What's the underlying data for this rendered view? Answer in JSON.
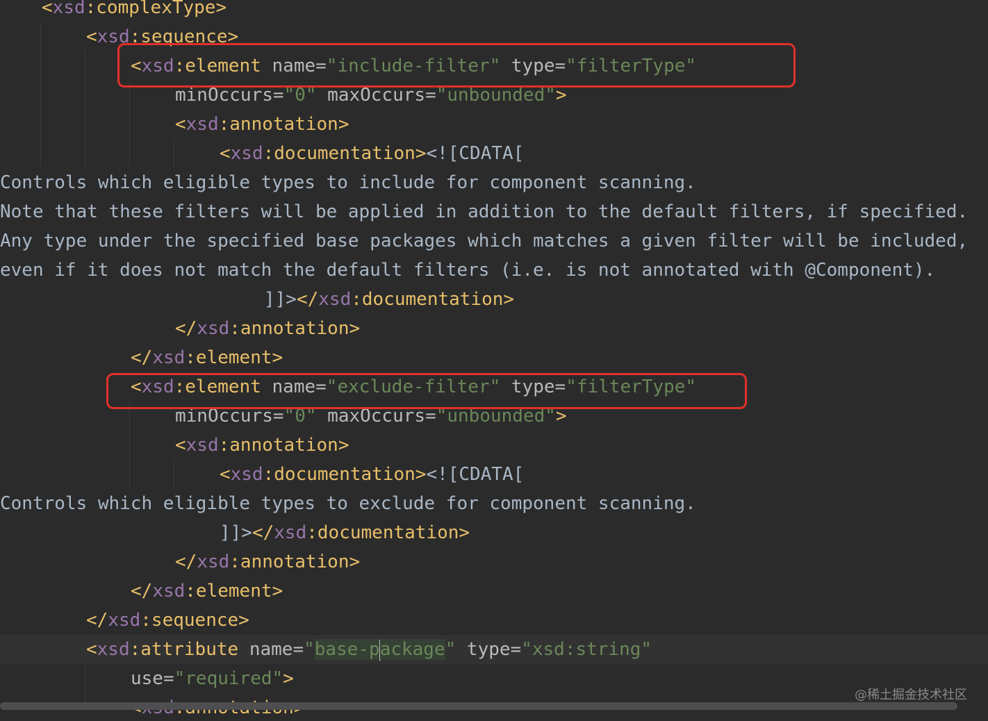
{
  "editor": {
    "language": "XML Schema (XSD)",
    "lines": [
      [
        {
          "c": "<",
          "k": "bracket"
        },
        {
          "c": "xsd",
          "k": "ns"
        },
        {
          "c": ":complexType",
          "k": "tag"
        },
        {
          "c": ">",
          "k": "bracket"
        }
      ],
      [
        {
          "c": "<",
          "k": "bracket"
        },
        {
          "c": "xsd",
          "k": "ns"
        },
        {
          "c": ":sequence",
          "k": "tag"
        },
        {
          "c": ">",
          "k": "bracket"
        }
      ],
      [
        {
          "c": "<",
          "k": "bracket"
        },
        {
          "c": "xsd",
          "k": "ns"
        },
        {
          "c": ":element",
          "k": "tag"
        },
        {
          "c": " name",
          "k": "attr"
        },
        {
          "c": "=",
          "k": "eq"
        },
        {
          "c": "\"include-filter\"",
          "k": "val"
        },
        {
          "c": " type",
          "k": "attr"
        },
        {
          "c": "=",
          "k": "eq"
        },
        {
          "c": "\"filterType\"",
          "k": "val"
        }
      ],
      [
        {
          "c": "minOccurs",
          "k": "attr"
        },
        {
          "c": "=",
          "k": "eq"
        },
        {
          "c": "\"0\"",
          "k": "val"
        },
        {
          "c": " maxOccurs",
          "k": "attr"
        },
        {
          "c": "=",
          "k": "eq"
        },
        {
          "c": "\"unbounded\"",
          "k": "val"
        },
        {
          "c": ">",
          "k": "bracket"
        }
      ],
      [
        {
          "c": "<",
          "k": "bracket"
        },
        {
          "c": "xsd",
          "k": "ns"
        },
        {
          "c": ":annotation",
          "k": "tag"
        },
        {
          "c": ">",
          "k": "bracket"
        }
      ],
      [
        {
          "c": "<",
          "k": "bracket"
        },
        {
          "c": "xsd",
          "k": "ns"
        },
        {
          "c": ":documentation",
          "k": "tag"
        },
        {
          "c": ">",
          "k": "bracket"
        },
        {
          "c": "<![CDATA[",
          "k": "cdata"
        }
      ],
      [
        {
          "c": "Controls which eligible types to include for component scanning.",
          "k": "text"
        }
      ],
      [
        {
          "c": "Note that these filters will be applied in addition to the default filters, if specified.",
          "k": "text"
        }
      ],
      [
        {
          "c": "Any type under the specified base packages which matches a given filter will be included,",
          "k": "text"
        }
      ],
      [
        {
          "c": "even if it does not match the default filters (i.e. is not annotated with @Component).",
          "k": "text"
        }
      ],
      [
        {
          "c": "]]>",
          "k": "cdata"
        },
        {
          "c": "</",
          "k": "bracket"
        },
        {
          "c": "xsd",
          "k": "ns"
        },
        {
          "c": ":documentation",
          "k": "tag"
        },
        {
          "c": ">",
          "k": "bracket"
        }
      ],
      [
        {
          "c": "</",
          "k": "bracket"
        },
        {
          "c": "xsd",
          "k": "ns"
        },
        {
          "c": ":annotation",
          "k": "tag"
        },
        {
          "c": ">",
          "k": "bracket"
        }
      ],
      [
        {
          "c": "</",
          "k": "bracket"
        },
        {
          "c": "xsd",
          "k": "ns"
        },
        {
          "c": ":element",
          "k": "tag"
        },
        {
          "c": ">",
          "k": "bracket"
        }
      ],
      [
        {
          "c": "<",
          "k": "bracket"
        },
        {
          "c": "xsd",
          "k": "ns"
        },
        {
          "c": ":element",
          "k": "tag"
        },
        {
          "c": " name",
          "k": "attr"
        },
        {
          "c": "=",
          "k": "eq"
        },
        {
          "c": "\"exclude-filter\"",
          "k": "val"
        },
        {
          "c": " type",
          "k": "attr"
        },
        {
          "c": "=",
          "k": "eq"
        },
        {
          "c": "\"filterType\"",
          "k": "val"
        }
      ],
      [
        {
          "c": "minOccurs",
          "k": "attr"
        },
        {
          "c": "=",
          "k": "eq"
        },
        {
          "c": "\"0\"",
          "k": "val"
        },
        {
          "c": " maxOccurs",
          "k": "attr"
        },
        {
          "c": "=",
          "k": "eq"
        },
        {
          "c": "\"unbounded\"",
          "k": "val"
        },
        {
          "c": ">",
          "k": "bracket"
        }
      ],
      [
        {
          "c": "<",
          "k": "bracket"
        },
        {
          "c": "xsd",
          "k": "ns"
        },
        {
          "c": ":annotation",
          "k": "tag"
        },
        {
          "c": ">",
          "k": "bracket"
        }
      ],
      [
        {
          "c": "<",
          "k": "bracket"
        },
        {
          "c": "xsd",
          "k": "ns"
        },
        {
          "c": ":documentation",
          "k": "tag"
        },
        {
          "c": ">",
          "k": "bracket"
        },
        {
          "c": "<![CDATA[",
          "k": "cdata"
        }
      ],
      [
        {
          "c": "Controls which eligible types to exclude for component scanning.",
          "k": "text"
        }
      ],
      [
        {
          "c": "]]>",
          "k": "cdata"
        },
        {
          "c": "</",
          "k": "bracket"
        },
        {
          "c": "xsd",
          "k": "ns"
        },
        {
          "c": ":documentation",
          "k": "tag"
        },
        {
          "c": ">",
          "k": "bracket"
        }
      ],
      [
        {
          "c": "</",
          "k": "bracket"
        },
        {
          "c": "xsd",
          "k": "ns"
        },
        {
          "c": ":annotation",
          "k": "tag"
        },
        {
          "c": ">",
          "k": "bracket"
        }
      ],
      [
        {
          "c": "</",
          "k": "bracket"
        },
        {
          "c": "xsd",
          "k": "ns"
        },
        {
          "c": ":element",
          "k": "tag"
        },
        {
          "c": ">",
          "k": "bracket"
        }
      ],
      [
        {
          "c": "</",
          "k": "bracket"
        },
        {
          "c": "xsd",
          "k": "ns"
        },
        {
          "c": ":sequence",
          "k": "tag"
        },
        {
          "c": ">",
          "k": "bracket"
        }
      ],
      [
        {
          "c": "<",
          "k": "bracket"
        },
        {
          "c": "xsd",
          "k": "ns"
        },
        {
          "c": ":attribute",
          "k": "tag"
        },
        {
          "c": " name",
          "k": "attr"
        },
        {
          "c": "=",
          "k": "eq"
        },
        {
          "c": "\"",
          "k": "val"
        },
        {
          "c": "base-p",
          "k": "val",
          "hl": true
        },
        {
          "c": "",
          "k": "caret"
        },
        {
          "c": "ackage",
          "k": "val",
          "hl": true
        },
        {
          "c": "\"",
          "k": "val"
        },
        {
          "c": " type",
          "k": "attr"
        },
        {
          "c": "=",
          "k": "eq"
        },
        {
          "c": "\"xsd:string\"",
          "k": "val"
        }
      ],
      [
        {
          "c": "use",
          "k": "attr"
        },
        {
          "c": "=",
          "k": "eq"
        },
        {
          "c": "\"required\"",
          "k": "val"
        },
        {
          "c": ">",
          "k": "bracket"
        }
      ],
      [
        {
          "c": "<",
          "k": "bracket"
        },
        {
          "c": "xsd",
          "k": "ns"
        },
        {
          "c": ":annotation",
          "k": "tag"
        },
        {
          "c": ">",
          "k": "bracket"
        }
      ]
    ]
  },
  "colors": {
    "background": "#2b2b2b",
    "caret_row": "#323232",
    "tag": "#e8bf6a",
    "namespace": "#9876aa",
    "attribute": "#bababa",
    "value": "#6a8759",
    "text": "#a9b7c6",
    "callout": "#e1312a"
  },
  "watermark": {
    "text": "@稀土掘金技术社区"
  }
}
